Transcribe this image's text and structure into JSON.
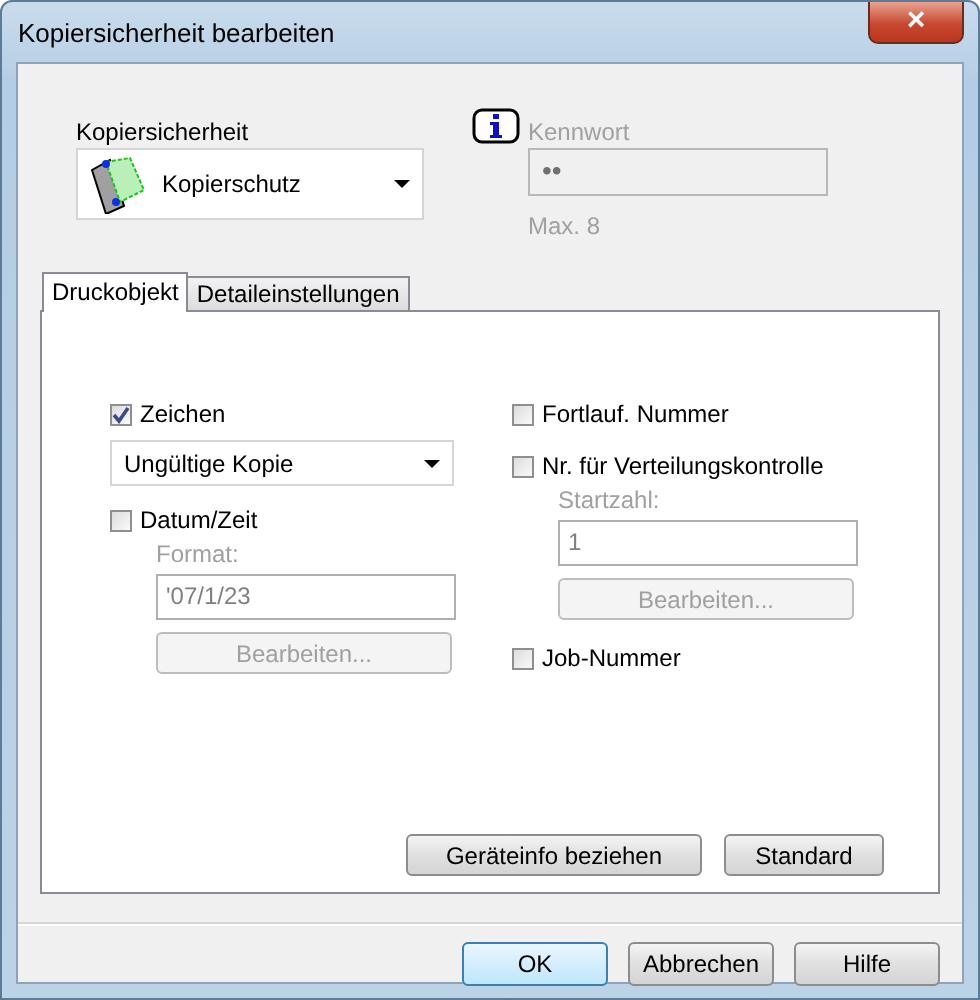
{
  "window": {
    "title": "Kopiersicherheit bearbeiten",
    "close": "×"
  },
  "security": {
    "label": "Kopiersicherheit",
    "value": "Kopierschutz"
  },
  "password": {
    "label": "Kennwort",
    "value": "••",
    "hint": "Max. 8",
    "disabled": true
  },
  "tabs": [
    {
      "label": "Druckobjekt",
      "selected": true
    },
    {
      "label": "Detaileinstellungen",
      "selected": false
    }
  ],
  "stamp": {
    "label": "Zeichen",
    "checked": true,
    "value": "Ungültige Kopie"
  },
  "datetime": {
    "label": "Datum/Zeit",
    "checked": false,
    "field_label": "Format:",
    "value": "'07/1/23",
    "button": "Bearbeiten..."
  },
  "serial": {
    "label": "Fortlauf. Nummer",
    "checked": false
  },
  "distribution": {
    "label": "Nr. für Verteilungskontrolle",
    "checked": false,
    "field_label": "Startzahl:",
    "value": "1",
    "button": "Bearbeiten..."
  },
  "job": {
    "label": "Job-Nummer",
    "checked": false
  },
  "panel_buttons": [
    "Geräteinfo beziehen",
    "Standard"
  ],
  "buttons": [
    {
      "label": "OK",
      "selected": true
    },
    {
      "label": "Abbrechen",
      "selected": false
    },
    {
      "label": "Hilfe",
      "selected": false
    }
  ]
}
